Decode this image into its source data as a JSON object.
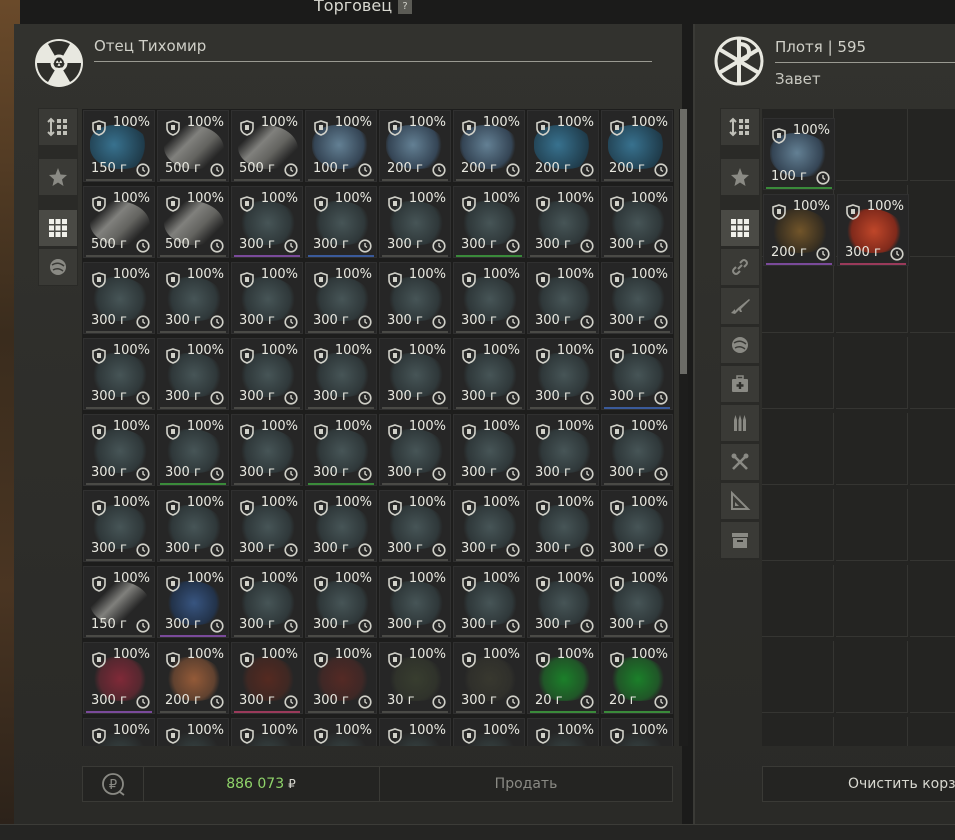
{
  "window": {
    "title": "Торговец",
    "help": "?"
  },
  "trader": {
    "name": "Отец Тихомир",
    "icon": "radiation-icon"
  },
  "player": {
    "name": "Плотя | 595",
    "faction": "Завет",
    "icon": "faction-emblem-icon"
  },
  "left_sidebar": [
    {
      "icon": "sort-icon"
    },
    {
      "icon": "favorite-star-icon"
    },
    {
      "icon": "all-items-grid-icon",
      "active": true
    },
    {
      "icon": "artifact-icon"
    }
  ],
  "right_sidebar": [
    {
      "icon": "sort-icon"
    },
    {
      "icon": "favorite-star-icon"
    },
    {
      "icon": "all-items-grid-icon",
      "active": true
    },
    {
      "icon": "link-icon"
    },
    {
      "icon": "rifle-icon"
    },
    {
      "icon": "artifact-icon"
    },
    {
      "icon": "medkit-icon"
    },
    {
      "icon": "ammo-icon"
    },
    {
      "icon": "tools-icon"
    },
    {
      "icon": "ruler-icon"
    },
    {
      "icon": "storage-box-icon"
    }
  ],
  "colors": {
    "money": "#8fd46a",
    "accent_green": "#3a8a3a",
    "accent_blue": "#3a5a9a",
    "accent_purple": "#7a4a9a",
    "accent_red": "#9a3a5a"
  },
  "trader_items": [
    [
      "150 г",
      "500 г",
      "500 г",
      "100 г",
      "200 г",
      "200 г",
      "200 г",
      "200 г"
    ],
    [
      "500 г",
      "500 г",
      "300 г",
      "300 г",
      "300 г",
      "300 г",
      "300 г",
      "300 г"
    ],
    [
      "300 г",
      "300 г",
      "300 г",
      "300 г",
      "300 г",
      "300 г",
      "300 г",
      "300 г"
    ],
    [
      "300 г",
      "300 г",
      "300 г",
      "300 г",
      "300 г",
      "300 г",
      "300 г",
      "300 г"
    ],
    [
      "300 г",
      "300 г",
      "300 г",
      "300 г",
      "300 г",
      "300 г",
      "300 г",
      "300 г"
    ],
    [
      "300 г",
      "300 г",
      "300 г",
      "300 г",
      "300 г",
      "300 г",
      "300 г",
      "300 г"
    ],
    [
      "150 г",
      "300 г",
      "300 г",
      "300 г",
      "300 г",
      "300 г",
      "300 г",
      "300 г"
    ],
    [
      "300 г",
      "200 г",
      "300 г",
      "300 г",
      "30 г",
      "300 г",
      "20 г",
      "20 г"
    ],
    [
      "",
      "",
      "",
      "",
      "",
      "",
      "",
      ""
    ]
  ],
  "durability": "100%",
  "player_items": [
    {
      "price": "100 г",
      "durability": "100%",
      "row": 0,
      "col": 0
    },
    {
      "price": "200 г",
      "durability": "100%",
      "row": 1,
      "col": 0
    },
    {
      "price": "300 г",
      "durability": "100%",
      "row": 1,
      "col": 1
    }
  ],
  "footer": {
    "money": "886 073",
    "currency": "₽",
    "sell_label": "Продать"
  },
  "cart": {
    "clear_label": "Очистить корзину"
  }
}
